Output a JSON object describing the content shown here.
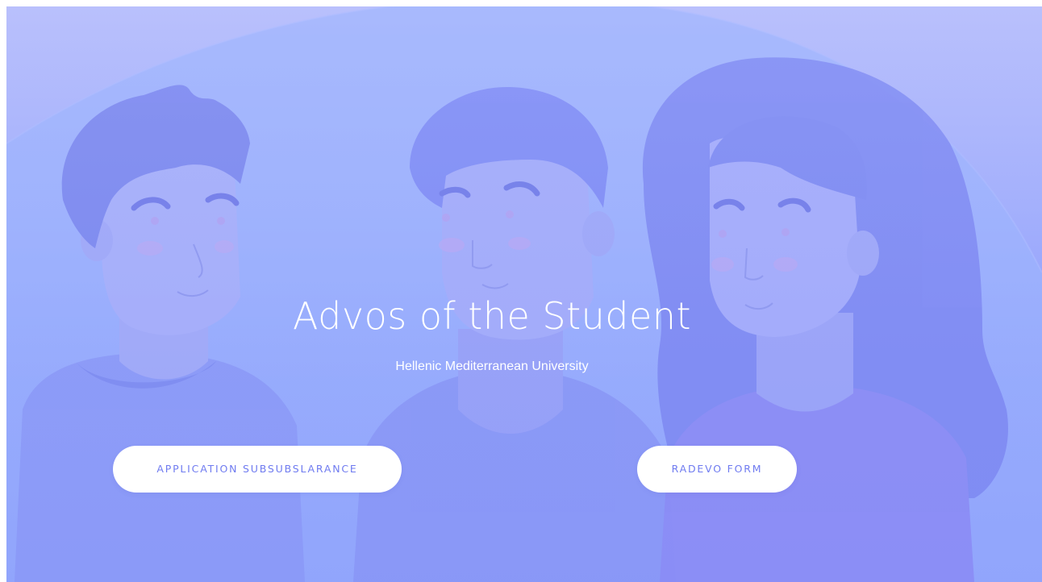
{
  "hero": {
    "title": "Advos of the Student",
    "subtitle": "Hellenic Mediterranean University"
  },
  "buttons": {
    "application_label": "APPLICATION SUBSUBSLARANCE",
    "radevo_label": "RADEVO FORM"
  },
  "colors": {
    "button_text": "#6f7bf0",
    "button_bg": "#ffffff",
    "hero_top": "#b8bffc",
    "hero_bottom": "#8291fb"
  }
}
